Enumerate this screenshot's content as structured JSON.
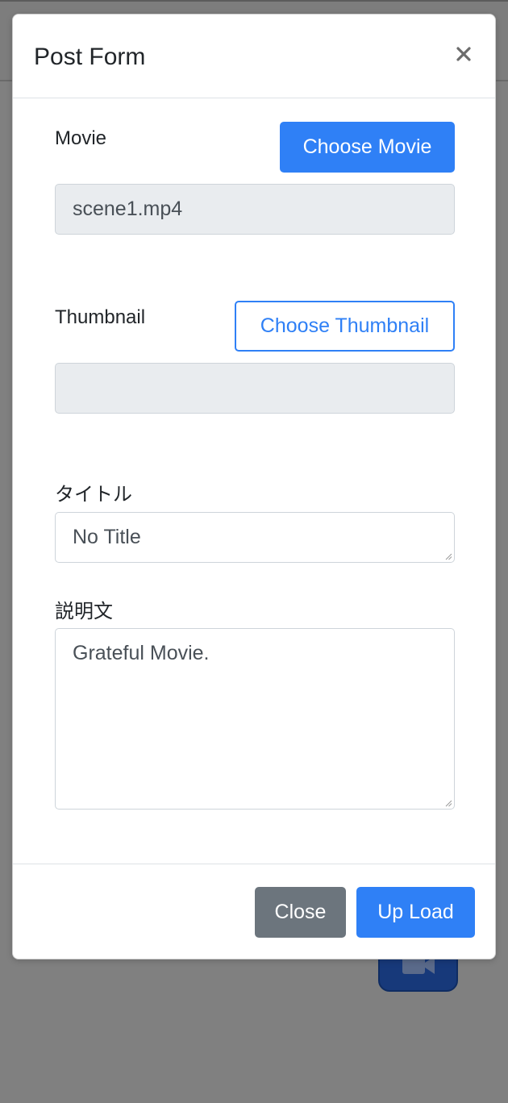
{
  "modal": {
    "title": "Post Form",
    "close_icon": "close-icon"
  },
  "movie": {
    "label": "Movie",
    "choose_button": "Choose Movie",
    "value": "scene1.mp4"
  },
  "thumbnail": {
    "label": "Thumbnail",
    "choose_button": "Choose Thumbnail",
    "value": ""
  },
  "title_field": {
    "label": "タイトル",
    "value": "No Title"
  },
  "description_field": {
    "label": "説明文",
    "value": "Grateful Movie."
  },
  "footer": {
    "close_button": "Close",
    "upload_button": "Up Load"
  },
  "colors": {
    "primary": "#2f80f6",
    "secondary": "#6c757d",
    "backdrop": "#808080",
    "fab": "#17397a"
  },
  "icons": {
    "backdrop_fab": "video-camera-icon"
  }
}
